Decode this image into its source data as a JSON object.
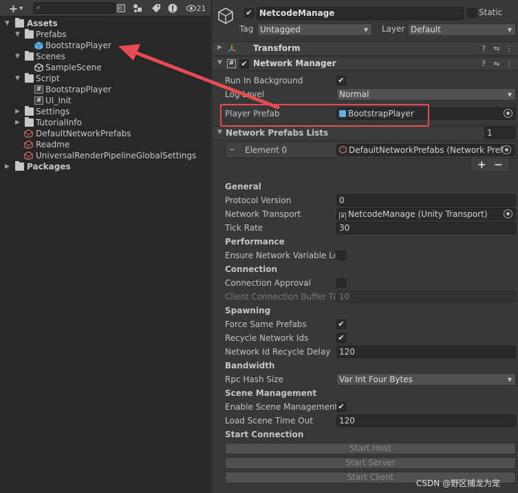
{
  "project_toolbar": {
    "add_label": "+",
    "add_arrow": "▾",
    "hidden_count": "21"
  },
  "tree": {
    "assets": "Assets",
    "prefabs": "Prefabs",
    "bootstrap_player": "BootstrapPlayer",
    "scenes": "Scenes",
    "sample_scene": "SampleScene",
    "script": "Script",
    "script_bootstrap": "BootstrapPlayer",
    "ui_init": "UI_Init",
    "settings": "Settings",
    "tutorial_info": "TutorialInfo",
    "default_network_prefabs": "DefaultNetworkPrefabs",
    "readme": "Readme",
    "urp_settings": "UniversalRenderPipelineGlobalSettings",
    "packages": "Packages"
  },
  "object": {
    "name": "NetcodeManage",
    "static_label": "Static",
    "tag_label": "Tag",
    "tag_value": "Untagged",
    "layer_label": "Layer",
    "layer_value": "Default"
  },
  "components": {
    "transform": "Transform",
    "network_manager": "Network Manager"
  },
  "fields": {
    "run_in_background": "Run In Background",
    "log_level": "Log Level",
    "log_level_value": "Normal",
    "player_prefab": "Player Prefab",
    "player_prefab_value": "BootstrapPlayer",
    "network_prefabs_lists": "Network Prefabs Lists",
    "network_prefabs_count": "1",
    "element0": "Element 0",
    "element0_value": "DefaultNetworkPrefabs (Network Prefa",
    "plus": "+",
    "minus": "−",
    "general": "General",
    "protocol_version": "Protocol Version",
    "protocol_version_value": "0",
    "network_transport": "Network Transport",
    "network_transport_value": "NetcodeManage (Unity Transport)",
    "tick_rate": "Tick Rate",
    "tick_rate_value": "30",
    "performance": "Performance",
    "ensure_variable_len": "Ensure Network Variable Len",
    "connection": "Connection",
    "connection_approval": "Connection Approval",
    "client_conn_buffer": "Client Connection Buffer Tim",
    "client_conn_buffer_value": "10",
    "spawning": "Spawning",
    "force_same_prefabs": "Force Same Prefabs",
    "recycle_network_ids": "Recycle Network Ids",
    "network_id_recycle_delay": "Network Id Recycle Delay",
    "network_id_recycle_delay_value": "120",
    "bandwidth": "Bandwidth",
    "rpc_hash_size": "Rpc Hash Size",
    "rpc_hash_size_value": "Var Int Four Bytes",
    "scene_management": "Scene Management",
    "enable_scene_management": "Enable Scene Management",
    "load_scene_timeout": "Load Scene Time Out",
    "load_scene_timeout_value": "120",
    "start_connection": "Start Connection",
    "start_host": "Start Host",
    "start_server": "Start Server",
    "start_client": "Start Client"
  },
  "checkmark": "✔",
  "watermark": "CSDN @野区捕龙为宠",
  "colors": {
    "annotation_red": "#e94b55",
    "prefab_blue": "#5fb0e6"
  }
}
